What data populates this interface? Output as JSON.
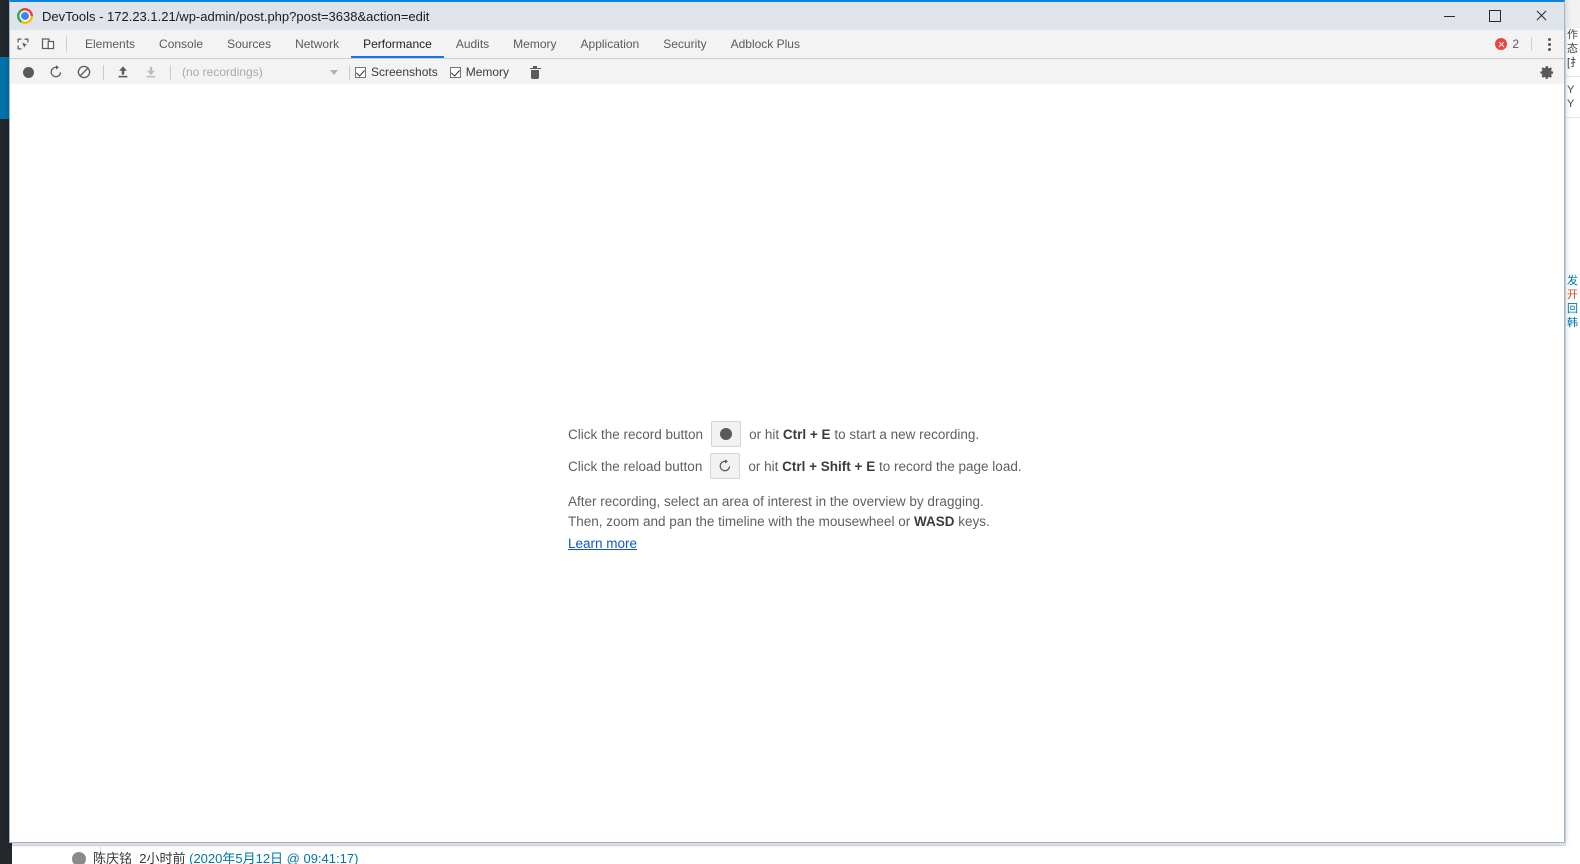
{
  "window": {
    "title": "DevTools - 172.23.1.21/wp-admin/post.php?post=3638&action=edit",
    "logo_icon": "chrome-logo-icon",
    "controls": {
      "minimize": "minimize-button",
      "maximize": "maximize-button",
      "close": "close-button"
    }
  },
  "tabstrip": {
    "inspect_icon": "inspect-element-icon",
    "device_icon": "toggle-device-toolbar-icon",
    "tabs": [
      {
        "label": "Elements",
        "active": false
      },
      {
        "label": "Console",
        "active": false
      },
      {
        "label": "Sources",
        "active": false
      },
      {
        "label": "Network",
        "active": false
      },
      {
        "label": "Performance",
        "active": true
      },
      {
        "label": "Audits",
        "active": false
      },
      {
        "label": "Memory",
        "active": false
      },
      {
        "label": "Application",
        "active": false
      },
      {
        "label": "Security",
        "active": false
      },
      {
        "label": "Adblock Plus",
        "active": false
      }
    ],
    "error_count": "2",
    "error_icon": "error-circle-icon",
    "more_icon": "more-options-kebab-icon",
    "active_underline_color": "#1a73e8"
  },
  "perf_toolbar": {
    "record_icon": "record-icon",
    "reload_icon": "reload-record-icon",
    "clear_icon": "clear-recording-icon",
    "upload_icon": "load-profile-icon",
    "download_icon": "save-profile-icon",
    "recordings_value": "(no recordings)",
    "recordings_caret_icon": "chevron-down-icon",
    "screenshots_label": "Screenshots",
    "screenshots_checked": true,
    "memory_label": "Memory",
    "memory_checked": true,
    "trash_icon": "collect-garbage-icon",
    "settings_icon": "gear-icon"
  },
  "landing": {
    "row1_prefix": "Click the record button",
    "row1_mid": "or hit",
    "row1_key1": "Ctrl",
    "row1_plus": "+",
    "row1_key2": "E",
    "row1_suffix": "to start a new recording.",
    "row2_prefix": "Click the reload button",
    "row2_mid": "or hit",
    "row2_key1": "Ctrl",
    "row2_key2": "Shift",
    "row2_key3": "E",
    "row2_suffix": "to record the page load.",
    "para_line1": "After recording, select an area of interest in the overview by dragging.",
    "para_line2_a": "Then, zoom and pan the timeline with the mousewheel or",
    "para_line2_key": "WASD",
    "para_line2_b": "keys.",
    "link_label": "Learn more",
    "record_btn_icon": "record-icon",
    "reload_btn_icon": "reload-icon"
  },
  "background_page": {
    "bottom_meta_author": "陈庆铭",
    "bottom_meta_time": "2小时前",
    "bottom_meta_date": "(2020年5月12日 @ 09:41:17)",
    "right_edge_lines": [
      "作",
      "态",
      "[扌",
      "Y",
      "Y",
      "发",
      "开",
      "回",
      "韩"
    ],
    "sidebar_accent": "#0073aa",
    "sidebar_bg": "#23282d"
  }
}
